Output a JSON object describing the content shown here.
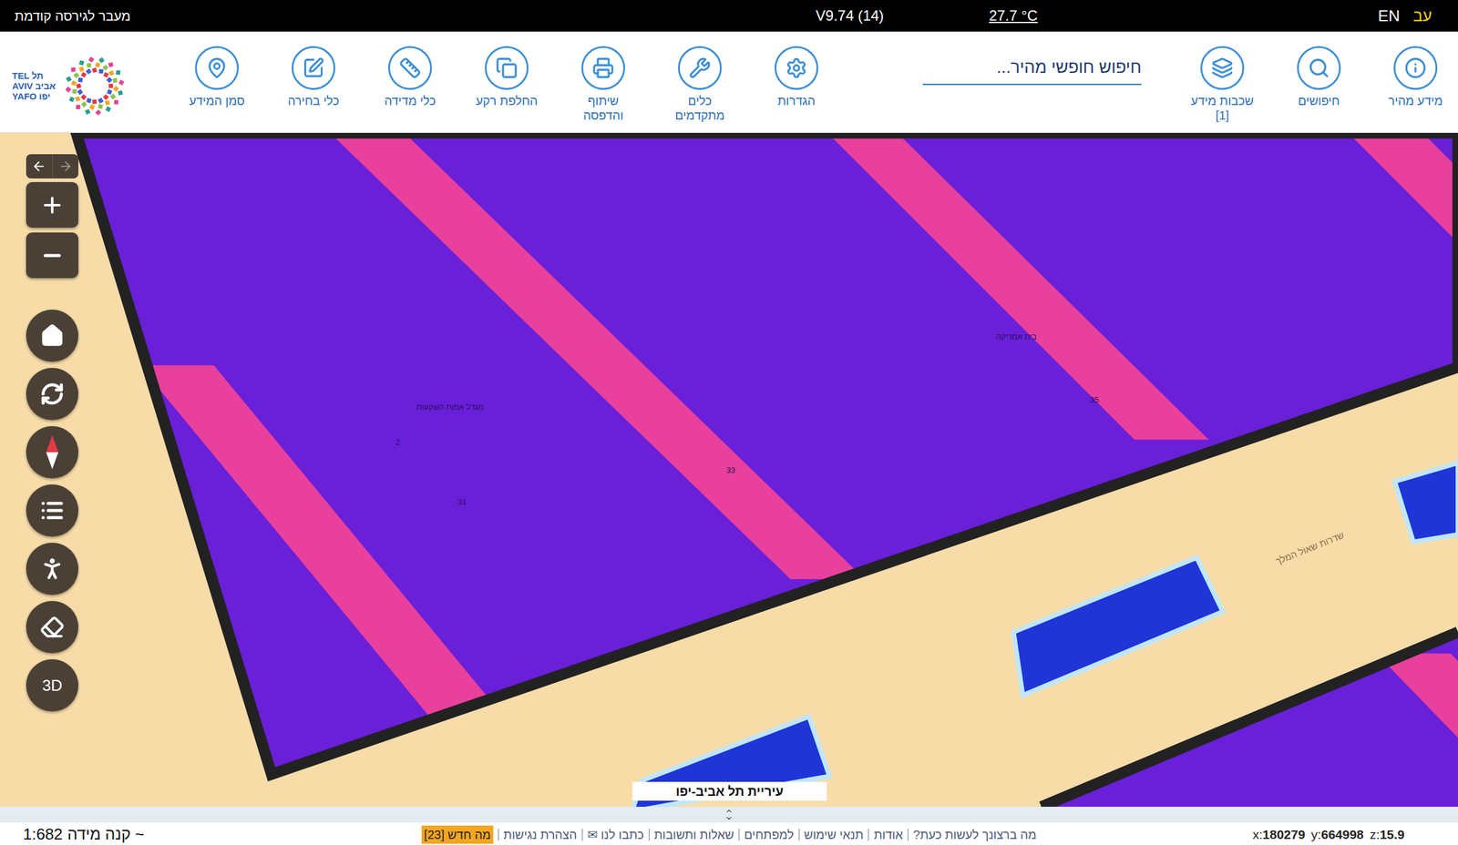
{
  "top_bar": {
    "previous_version": "מעבר לגירסה קודמת",
    "version": "V9.74 (14)",
    "temperature": "27.7 °C",
    "languages": [
      {
        "label": "EN",
        "selected": false
      },
      {
        "label": "עב",
        "selected": true
      }
    ]
  },
  "toolbar": {
    "leading": [
      {
        "lines": [
          "מידע מהיר"
        ]
      },
      {
        "lines": [
          "חיפושים"
        ]
      },
      {
        "lines": [
          "שכבות מידע",
          "[1]"
        ]
      }
    ],
    "search": {
      "placeholder": "חיפוש חופשי מהיר..."
    },
    "trailing": [
      {
        "lines": [
          "הגדרות"
        ]
      },
      {
        "lines": [
          "כלים",
          "מתקדמים"
        ]
      },
      {
        "lines": [
          "שיתוף",
          "והדפסה"
        ]
      },
      {
        "lines": [
          "החלפת רקע"
        ]
      },
      {
        "lines": [
          "כלי מדידה"
        ]
      },
      {
        "lines": [
          "כלי בחירה"
        ]
      },
      {
        "lines": [
          "סמן המידע"
        ]
      }
    ]
  },
  "logo": {
    "rows": [
      {
        "english": "TEL",
        "hebrew": "תל"
      },
      {
        "english": "AVIV",
        "hebrew": "אביב"
      },
      {
        "english": "YAFO",
        "hebrew": "יפו"
      }
    ]
  },
  "map": {
    "labels": [
      "מגדל אמות השקעות",
      "2",
      "31",
      "33",
      "35",
      "בית אמריקה",
      "שדרות שאול המלך"
    ],
    "attribution": "עיריית תל אביב-יפו",
    "view_3d": "3D"
  },
  "footer": {
    "scale_label": "קנה מידה ~",
    "scale_value": "1:682",
    "links": [
      {
        "label": "מה ברצונך לעשות כעת?",
        "highlighted": false
      },
      {
        "label": "אודות",
        "highlighted": false
      },
      {
        "label": "תנאי שימוש",
        "highlighted": false
      },
      {
        "label": "למפתחים",
        "highlighted": false
      },
      {
        "label": "שאלות ותשובות",
        "highlighted": false
      },
      {
        "label": "כתבו לנו ✉",
        "highlighted": false
      },
      {
        "label": "הצהרת נגישות",
        "highlighted": false
      },
      {
        "label": "מה חדש [23]",
        "highlighted": true
      }
    ],
    "coordinates": [
      {
        "axis": "x:",
        "value": "180279"
      },
      {
        "axis": "y:",
        "value": "664998"
      },
      {
        "axis": "z:",
        "value": "15.9"
      }
    ]
  }
}
